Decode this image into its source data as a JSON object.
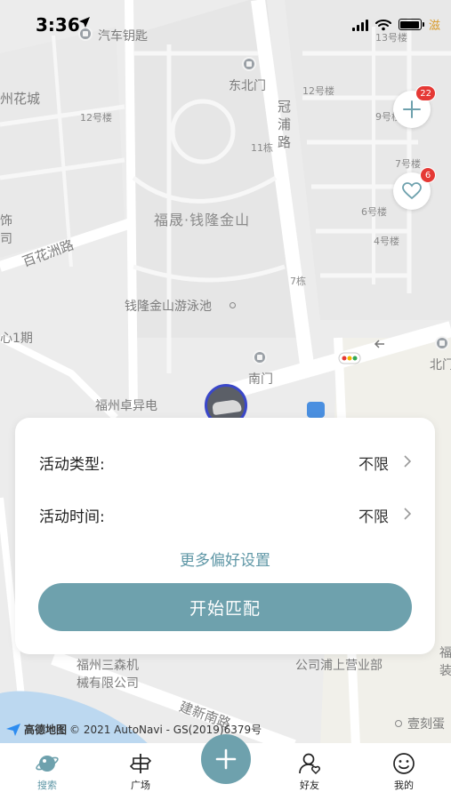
{
  "status_bar": {
    "time": "3:36",
    "extra": "滋"
  },
  "map": {
    "labels": {
      "car_key": "汽车钥匙",
      "flower_city": "州花城",
      "bldg_12_left": "12号楼",
      "north_gate": "东北门",
      "guanpu_road": "冠浦路",
      "bldg_12_right": "12号楼",
      "bldg_13": "13号楼",
      "bldg_9": "9号楼",
      "bldg_11": "11栋",
      "bldg_7": "7号楼",
      "bldg_6": "6号楼",
      "bldg_4": "4号楼",
      "fusheng": "福晟·钱隆金山",
      "baihuazhou_road": "百花洲路",
      "shi": "饰",
      "si": "司",
      "bldg_7_dong": "7栋",
      "pool": "钱隆金山游泳池",
      "phase1": "心1期",
      "south_gate": "南门",
      "north_gate_right": "北门",
      "zhuoyi": "福州卓异电",
      "sansen_1": "福州三森机",
      "sansen_2": "械有限公司",
      "pushang": "公司浦上营业部",
      "jianxin_road": "建新南路",
      "cake": "壹刻蛋",
      "right_edge_1": "福",
      "right_edge_2": "装"
    },
    "attribution": "© 2021 AutoNavi - GS(2019)6379号",
    "attribution_brand": "高德地图"
  },
  "floating": {
    "add_badge": "22",
    "fav_badge": "6"
  },
  "panel": {
    "activity_type_label": "活动类型:",
    "activity_type_value": "不限",
    "activity_time_label": "活动时间:",
    "activity_time_value": "不限",
    "more_prefs": "更多偏好设置",
    "start_button": "开始匹配"
  },
  "tabbar": {
    "tabs": [
      {
        "label": "搜索",
        "icon": "planet-icon"
      },
      {
        "label": "广场",
        "icon": "signpost-icon"
      },
      {
        "label": "好友",
        "icon": "friend-icon"
      },
      {
        "label": "我的",
        "icon": "smiley-icon"
      }
    ],
    "center_icon": "plus-icon"
  },
  "colors": {
    "accent": "#6ea1ad",
    "accent_text": "#5f97a6",
    "badge": "#e53935",
    "marker_border": "#3a47c9"
  }
}
